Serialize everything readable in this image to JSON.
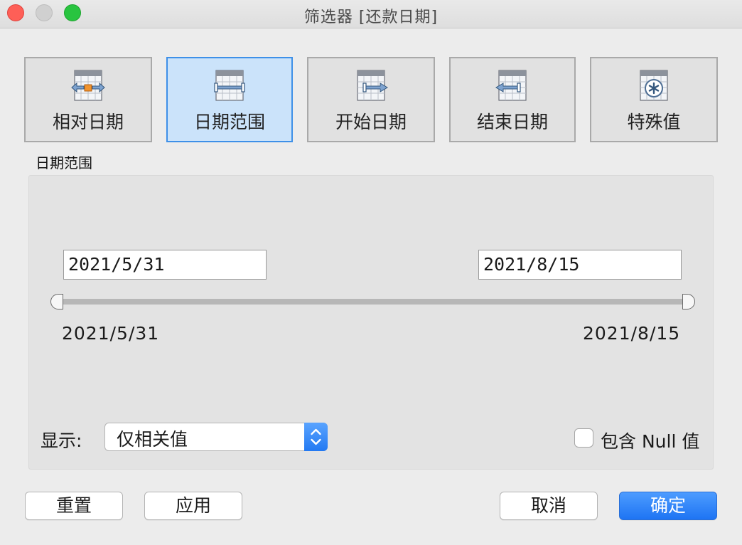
{
  "window": {
    "title": "筛选器 [还款日期]"
  },
  "mode_tabs": [
    {
      "label": "相对日期",
      "icon": "relative-date-icon",
      "active": false
    },
    {
      "label": "日期范围",
      "icon": "date-range-icon",
      "active": true
    },
    {
      "label": "开始日期",
      "icon": "start-date-icon",
      "active": false
    },
    {
      "label": "结束日期",
      "icon": "end-date-icon",
      "active": false
    },
    {
      "label": "特殊值",
      "icon": "special-value-icon",
      "active": false
    }
  ],
  "section": {
    "label": "日期范围",
    "start_value": "2021/5/31",
    "end_value": "2021/8/15",
    "range_min_label": "2021/5/31",
    "range_max_label": "2021/8/15",
    "slider_start_fraction": 0,
    "slider_end_fraction": 1
  },
  "display": {
    "label": "显示:",
    "selected_option": "仅相关值"
  },
  "include_null": {
    "label": "包含 Null 值",
    "checked": false
  },
  "footer": {
    "reset": "重置",
    "apply": "应用",
    "cancel": "取消",
    "ok": "确定"
  },
  "colors": {
    "active_tab_bg": "#cbe3fa",
    "active_tab_border": "#3e90e8",
    "primary_button": "#1e74f3",
    "icon_accent": "#f0932e"
  }
}
